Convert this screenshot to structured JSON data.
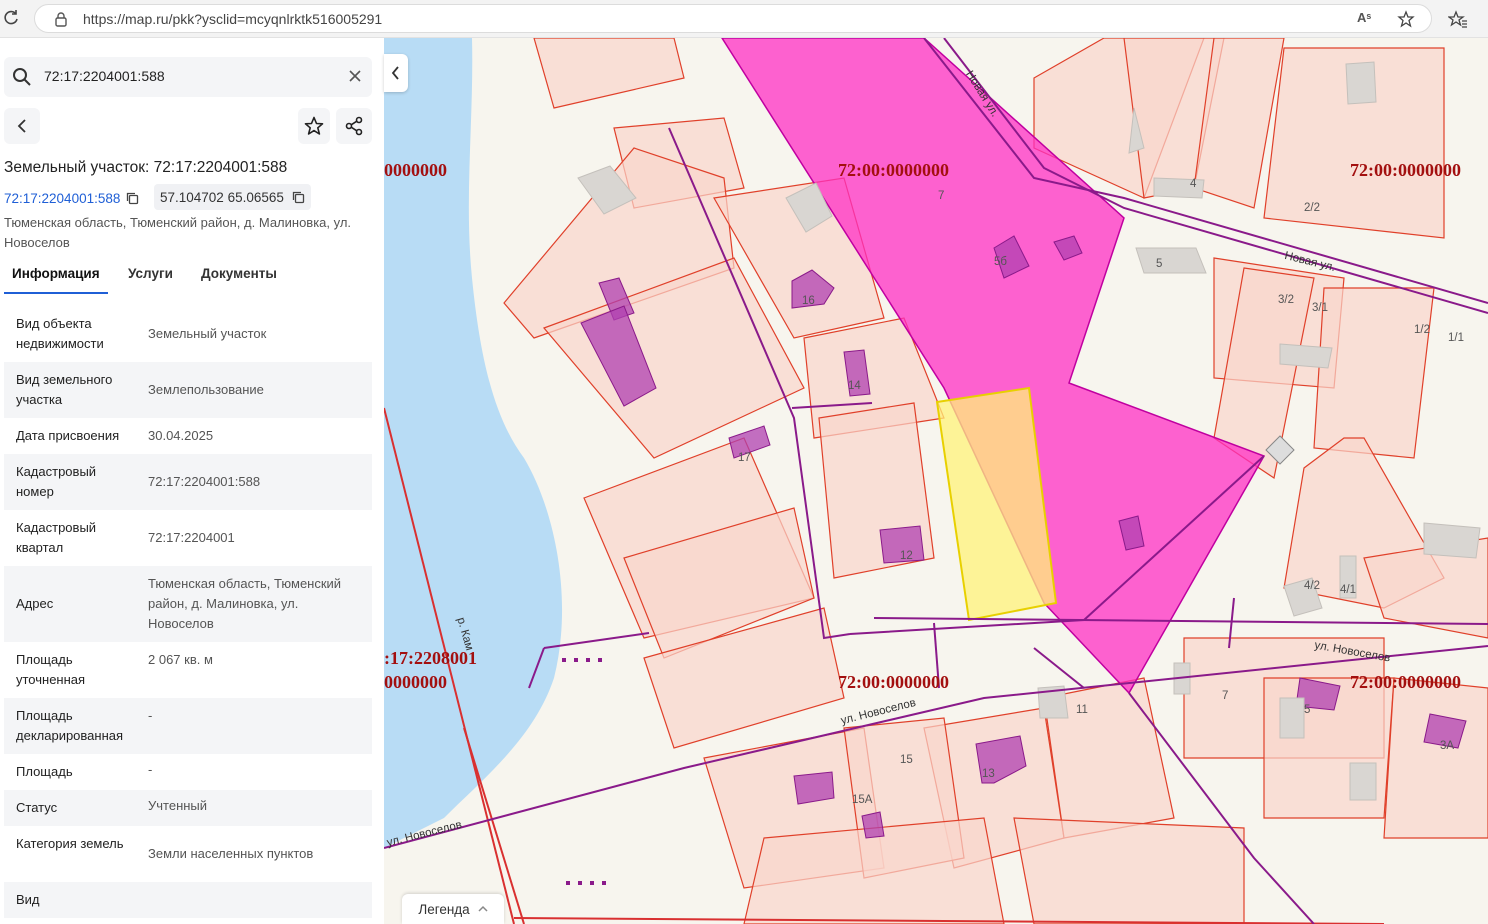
{
  "browser": {
    "url": "https://map.ru/pkk?ysclid=mcyqnlrktk516005291",
    "read_aloud_label": "Aˢ"
  },
  "panel": {
    "search_value": "72:17:2204001:588",
    "title": "Земельный участок: 72:17:2204001:588",
    "cad_link": "72:17:2204001:588",
    "coords": "57.104702 65.06565",
    "address": "Тюменская область, Тюменский район, д. Малиновка, ул. Новоселов",
    "tabs": [
      "Информация",
      "Услуги",
      "Документы"
    ],
    "properties": [
      {
        "key": "Вид объекта недвижимости",
        "value": "Земельный участок"
      },
      {
        "key": "Вид земельного участка",
        "value": "Землепользование"
      },
      {
        "key": "Дата присвоения",
        "value": "30.04.2025"
      },
      {
        "key": "Кадастровый номер",
        "value": "72:17:2204001:588"
      },
      {
        "key": "Кадастровый квартал",
        "value": "72:17:2204001"
      },
      {
        "key": "Адрес",
        "value": "Тюменская область, Тюменский район, д. Малиновка, ул. Новоселов"
      },
      {
        "key": "Площадь уточненная",
        "value": "2 067 кв. м"
      },
      {
        "key": "Площадь декларированная",
        "value": "-"
      },
      {
        "key": "Площадь",
        "value": "-"
      },
      {
        "key": "Статус",
        "value": "Учтенный"
      },
      {
        "key": "Категория земель",
        "value": "Земли населенных пунктов"
      },
      {
        "key": "Вид",
        "value": ""
      }
    ]
  },
  "map": {
    "legend_label": "Легенда",
    "cad_labels": [
      "0000000",
      "72:00:0000000",
      "72:00:0000000",
      ":17:2208001",
      "0000000",
      "72:00:0000000",
      "72:00:0000000"
    ],
    "streets": [
      "Новая ул.",
      "Новая ул.",
      "ул. Новоселов",
      "ул. Новоселов",
      "ул. Новоселов",
      "р. Кам"
    ],
    "houses": [
      "7",
      "5б",
      "16",
      "14",
      "17",
      "12",
      "4",
      "2/2",
      "5",
      "3/2",
      "3/1",
      "1/2",
      "1/1",
      "4/2",
      "4/1",
      "7",
      "5",
      "3А",
      "11",
      "15",
      "15А",
      "13"
    ],
    "colors": {
      "parcel_fill": "#f9d6cc",
      "parcel_stroke": "#e0402a",
      "magenta": "#ff2fc4",
      "selected": "#fff27a",
      "water": "#b8dcf5",
      "cad_label": "#a31010"
    }
  }
}
